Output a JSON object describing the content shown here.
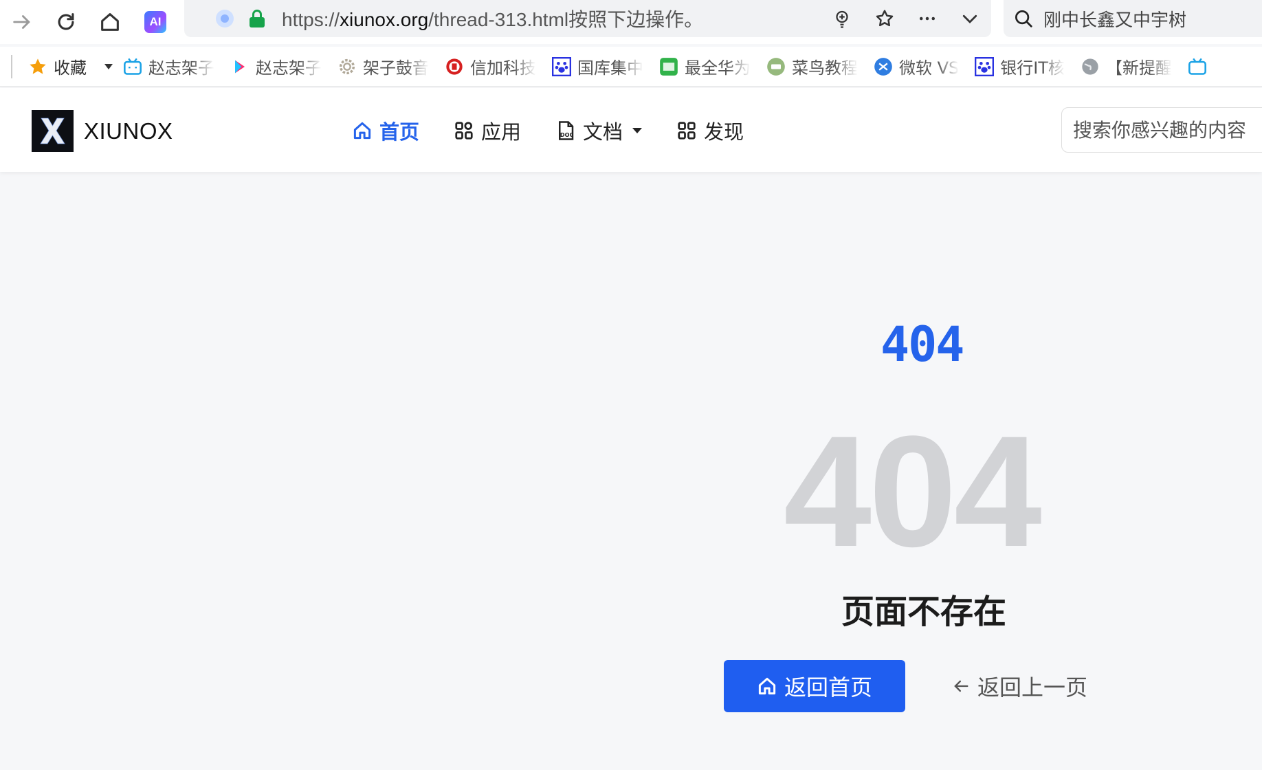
{
  "browser": {
    "url_prefix": "https://",
    "url_host": "xiunox.org",
    "url_rest": "/thread-313.html按照下边操作。",
    "ai_label": "AI",
    "search_text": "刚中长鑫又中宇树"
  },
  "bookmarks": {
    "folder_label": "收藏",
    "items": [
      {
        "label": "赵志架子",
        "icon": "bilibili-icon"
      },
      {
        "label": "赵志架子",
        "icon": "youku-icon"
      },
      {
        "label": "架子鼓音",
        "icon": "gear-icon"
      },
      {
        "label": "信加科技",
        "icon": "red-seal-icon"
      },
      {
        "label": "国库集中",
        "icon": "paw-icon"
      },
      {
        "label": "最全华为",
        "icon": "green-badge-icon"
      },
      {
        "label": "菜鸟教程",
        "icon": "runoob-icon"
      },
      {
        "label": "微软 VS",
        "icon": "vs-icon"
      },
      {
        "label": "银行IT核",
        "icon": "paw-icon"
      },
      {
        "label": "【新提醒",
        "icon": "globe-icon"
      }
    ]
  },
  "site": {
    "logo_text": "XIUNOX",
    "nav": [
      {
        "label": "首页",
        "icon": "home-icon",
        "active": true
      },
      {
        "label": "应用",
        "icon": "apps-icon",
        "active": false
      },
      {
        "label": "文档",
        "icon": "doc-icon",
        "active": false,
        "dropdown": true
      },
      {
        "label": "发现",
        "icon": "grid-icon",
        "active": false
      }
    ],
    "search_placeholder": "搜索你感兴趣的内容"
  },
  "error": {
    "code_small": "404",
    "code_big": "404",
    "message": "页面不存在",
    "home_button": "返回首页",
    "back_button": "返回上一页"
  },
  "colors": {
    "accent": "#2563eb",
    "button": "#1f5ef0",
    "big_code": "#d2d3d6",
    "background": "#f6f7f9"
  }
}
